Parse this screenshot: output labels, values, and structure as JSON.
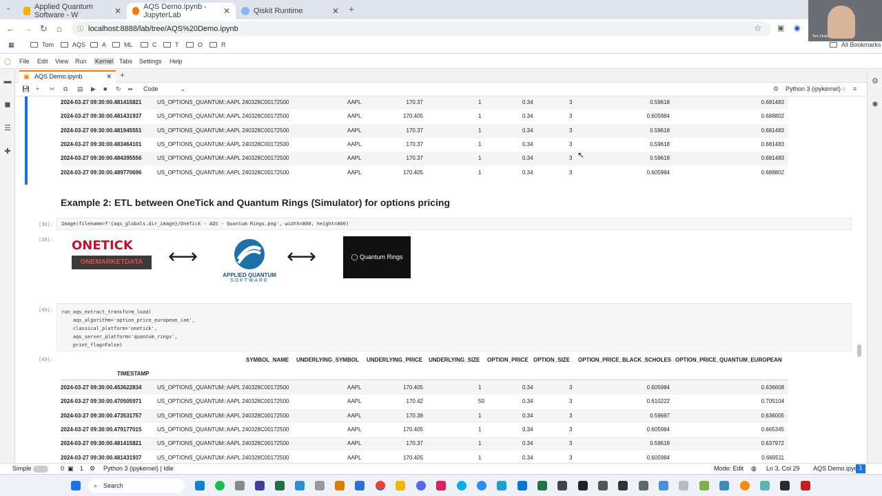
{
  "browser": {
    "tabs": [
      {
        "title": "Applied Quantum Software - W",
        "color": "#f4b400"
      },
      {
        "title": "AQS Demo.ipynb - JupyterLab",
        "color": "#f57c00"
      },
      {
        "title": "Qiskit Runtime",
        "color": "#8ab4f8"
      }
    ],
    "url": "localhost:8888/lab/tree/AQS%20Demo.ipynb",
    "bookmarks": [
      "Tom",
      "AQS",
      "A",
      "ML",
      "C",
      "T",
      "O",
      "R"
    ],
    "all_bookmarks": "All Bookmarks"
  },
  "jupyter": {
    "menu": [
      "File",
      "Edit",
      "View",
      "Run",
      "Kernel",
      "Tabs",
      "Settings",
      "Help"
    ],
    "notebook_tab": "AQS Demo.ipynb",
    "cell_type": "Code",
    "kernel": "Python 3 (ipykernel)"
  },
  "table1": [
    [
      "2024-03-27 09:30:00.481415821",
      "US_OPTIONS_QUANTUM::AAPL 240328C00172500",
      "AAPL",
      "170.37",
      "1",
      "0.34",
      "3",
      "0.59618",
      "0.681483"
    ],
    [
      "2024-03-27 09:30:00.481431937",
      "US_OPTIONS_QUANTUM::AAPL 240328C00172500",
      "AAPL",
      "170.405",
      "1",
      "0.34",
      "3",
      "0.605984",
      "0.688802"
    ],
    [
      "2024-03-27 09:30:00.481945551",
      "US_OPTIONS_QUANTUM::AAPL 240328C00172500",
      "AAPL",
      "170.37",
      "1",
      "0.34",
      "3",
      "0.59618",
      "0.681483"
    ],
    [
      "2024-03-27 09:30:00.483464101",
      "US_OPTIONS_QUANTUM::AAPL 240328C00172500",
      "AAPL",
      "170.37",
      "1",
      "0.34",
      "3",
      "0.59618",
      "0.681483"
    ],
    [
      "2024-03-27 09:30:00.484395556",
      "US_OPTIONS_QUANTUM::AAPL 240328C00172500",
      "AAPL",
      "170.37",
      "1",
      "0.34",
      "3",
      "0.59618",
      "0.681483"
    ],
    [
      "2024-03-27 09:30:00.489770696",
      "US_OPTIONS_QUANTUM::AAPL 240328C00172500",
      "AAPL",
      "170.405",
      "1",
      "0.34",
      "3",
      "0.605984",
      "0.688802"
    ]
  ],
  "heading": "Example 2: ETL between OneTick and Quantum Rings (Simulator) for options pricing",
  "cell30": {
    "prompt": "[30]:",
    "code": "Image(filename=f'{aqs_globals.dir_image}/OneTick - AQS - Quantum Rings.png', width=800, height=800)",
    "out_prompt": "[30]:"
  },
  "logos": {
    "onetick": "ONETICK",
    "onemarketdata": "ONEMARKETDATA",
    "aqs_line1": "APPLIED QUANTUM",
    "aqs_line2": "SOFTWARE",
    "qr": "Quantum Rings"
  },
  "cell49": {
    "prompt": "[49]:",
    "lines": [
      "run_aqs_extract_transform_load(",
      "    aqs_algorithm='option_price_european_iae',",
      "    classical_platform='onetick',",
      "    aqs_server_platform='quantum_rings',",
      "    print_flag=False)"
    ],
    "out_prompt": "[49]:"
  },
  "table2_headers": [
    "SYMBOL_NAME",
    "UNDERLYING_SYMBOL",
    "UNDERLYING_PRICE",
    "UNDERLYING_SIZE",
    "OPTION_PRICE",
    "OPTION_SIZE",
    "OPTION_PRICE_BLACK_SCHOLES",
    "OPTION_PRICE_QUANTUM_EUROPEAN"
  ],
  "table2_index": "TIMESTAMP",
  "table2": [
    [
      "2024-03-27 09:30:00.453622834",
      "US_OPTIONS_QUANTUM::AAPL 240328C00172500",
      "AAPL",
      "170.405",
      "1",
      "0.34",
      "3",
      "0.605984",
      "0.636608"
    ],
    [
      "2024-03-27 09:30:00.470505971",
      "US_OPTIONS_QUANTUM::AAPL 240328C00172500",
      "AAPL",
      "170.42",
      "50",
      "0.34",
      "3",
      "0.610222",
      "0.705104"
    ],
    [
      "2024-03-27 09:30:00.473531757",
      "US_OPTIONS_QUANTUM::AAPL 240328C00172500",
      "AAPL",
      "170.38",
      "1",
      "0.34",
      "3",
      "0.59697",
      "0.636005"
    ],
    [
      "2024-03-27 09:30:00.479177015",
      "US_OPTIONS_QUANTUM::AAPL 240328C00172500",
      "AAPL",
      "170.405",
      "1",
      "0.34",
      "3",
      "0.605984",
      "0.665345"
    ],
    [
      "2024-03-27 09:30:00.481415821",
      "US_OPTIONS_QUANTUM::AAPL 240328C00172500",
      "AAPL",
      "170.37",
      "1",
      "0.34",
      "3",
      "0.59618",
      "0.637972"
    ],
    [
      "2024-03-27 09:30:00.481431937",
      "US_OPTIONS_QUANTUM::AAPL 240328C00172500",
      "AAPL",
      "170.405",
      "1",
      "0.34",
      "3",
      "0.605984",
      "0.669511"
    ]
  ],
  "status": {
    "simple": "Simple",
    "num1": "0",
    "num2": "1",
    "kernel": "Python 3 (ipykernel) | Idle",
    "mode": "Mode: Edit",
    "pos": "Ln 3, Col 29",
    "file": "AQS Demo.ipynb",
    "badge": "1"
  },
  "taskbar": {
    "search": "Search"
  },
  "webcam_label": "Tom Finke"
}
